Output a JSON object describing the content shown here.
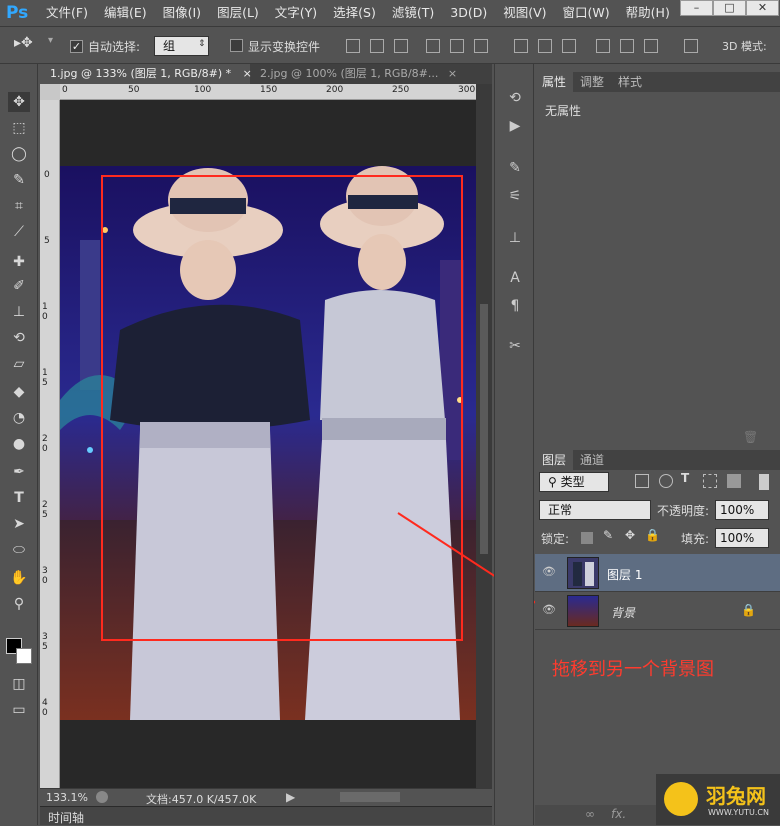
{
  "app": {
    "logo": "Ps"
  },
  "menu": [
    "文件(F)",
    "编辑(E)",
    "图像(I)",
    "图层(L)",
    "文字(Y)",
    "选择(S)",
    "滤镜(T)",
    "3D(D)",
    "视图(V)",
    "窗口(W)",
    "帮助(H)"
  ],
  "window_controls": {
    "minimize": "–",
    "restore": "□",
    "close": "✕"
  },
  "options": {
    "auto_select_label": "自动选择:",
    "auto_select_value": "组",
    "show_transform_label": "显示变换控件",
    "mode_3d": "3D 模式:"
  },
  "tabs": [
    {
      "label": "1.jpg @ 133% (图层 1, RGB/8#) *",
      "close": "×"
    },
    {
      "label": "2.jpg @ 100% (图层 1, RGB/8#...",
      "close": "×"
    }
  ],
  "ruler_top": [
    "0",
    "50",
    "100",
    "150",
    "200",
    "250",
    "300"
  ],
  "ruler_left": [
    "0",
    "5",
    "1 0",
    "1 5",
    "2 0",
    "2 5",
    "3 0",
    "3 5",
    "4 0"
  ],
  "status": {
    "zoom": "133.1%",
    "doc": "文档:457.0 K/457.0K"
  },
  "timeline": "时间轴",
  "properties": {
    "tabs": [
      "属性",
      "调整",
      "样式"
    ],
    "content": "无属性"
  },
  "layers_panel": {
    "tabs": [
      "图层",
      "通道"
    ],
    "filter": "类型",
    "blend": "正常",
    "opacity_label": "不透明度:",
    "opacity": "100%",
    "lock_label": "锁定:",
    "fill_label": "填充:",
    "fill": "100%",
    "layers": [
      {
        "name": "图层 1",
        "selected": true
      },
      {
        "name": "背景",
        "locked": true
      }
    ]
  },
  "annotation": "拖移到另一个背景图",
  "watermark": {
    "brand": "羽兔网",
    "url": "WWW.YUTU.CN"
  },
  "colors": {
    "annotation": "#ff3b2e",
    "selected_layer": "#5e6d82",
    "ps_blue": "#31a8ff"
  }
}
